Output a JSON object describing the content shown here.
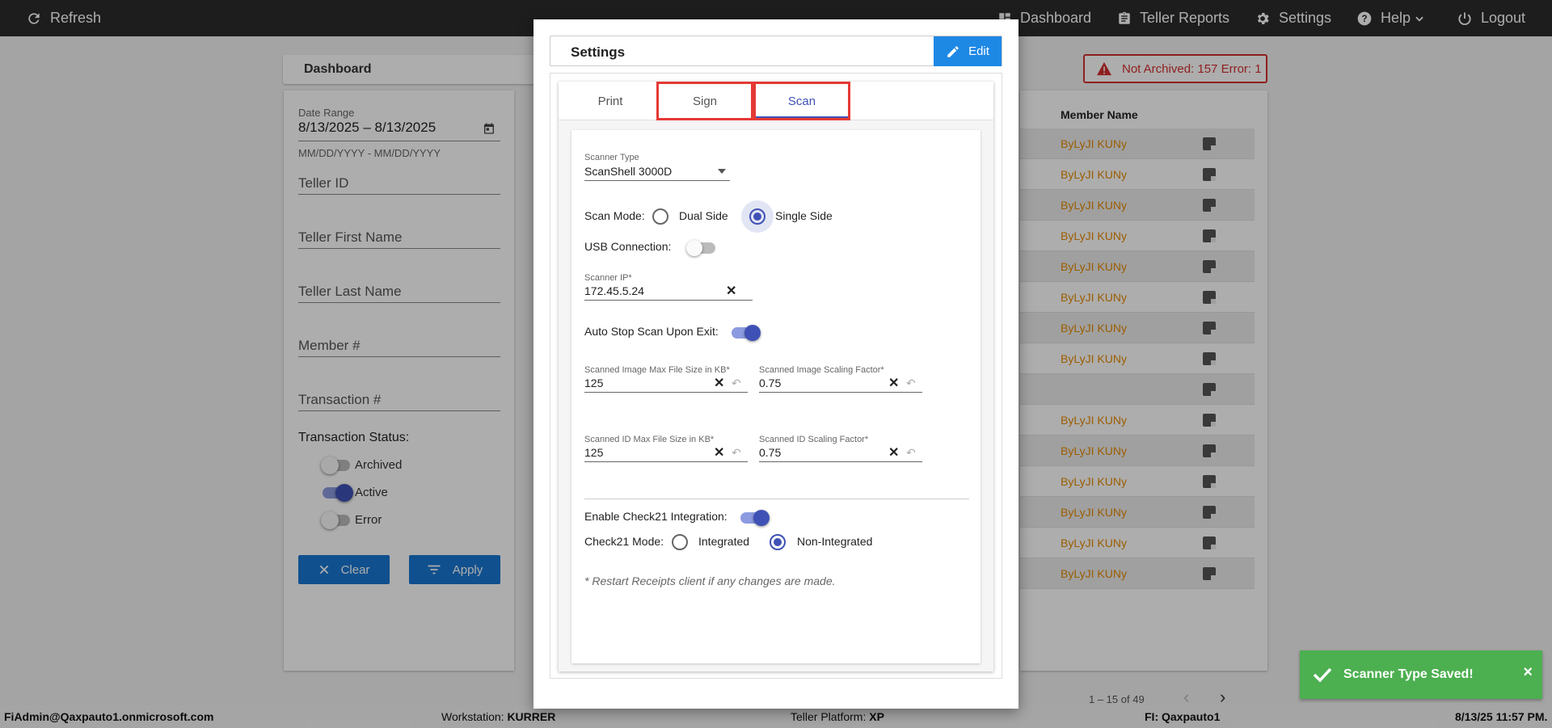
{
  "topbar": {
    "refresh_label": "Refresh",
    "dashboard_label": "Dashboard",
    "teller_reports_label": "Teller Reports",
    "settings_label": "Settings",
    "help_label": "Help",
    "logout_label": "Logout"
  },
  "dashboard": {
    "title": "Dashboard",
    "filters": {
      "date_range_label": "Date Range",
      "date_range_value": "8/13/2025 – 8/13/2025",
      "date_range_hint": "MM/DD/YYYY - MM/DD/YYYY",
      "teller_id_placeholder": "Teller ID",
      "teller_first_name_placeholder": "Teller First Name",
      "teller_last_name_placeholder": "Teller Last Name",
      "member_placeholder": "Member #",
      "transaction_placeholder": "Transaction #",
      "status_heading": "Transaction Status:",
      "statuses": [
        {
          "label": "Archived",
          "on": false
        },
        {
          "label": "Active",
          "on": true
        },
        {
          "label": "Error",
          "on": false
        }
      ],
      "clear_label": "Clear",
      "apply_label": "Apply"
    },
    "alert": {
      "text": "Not Archived: 157  Error: 1",
      "color": "#d32f2f"
    },
    "table": {
      "column_member_name": "Member Name",
      "rows": [
        "ByLyJI KUNy",
        "ByLyJI KUNy",
        "ByLyJI KUNy",
        "ByLyJI KUNy",
        "ByLyJI KUNy",
        "ByLyJI KUNy",
        "ByLyJI KUNy",
        "ByLyJI KUNy",
        "",
        "ByLyJI KUNy",
        "ByLyJI KUNy",
        "ByLyJI KUNy",
        "ByLyJI KUNy",
        "ByLyJI KUNy",
        "ByLyJI KUNy"
      ],
      "pager_text": "1 – 15 of 49"
    }
  },
  "settings_modal": {
    "title": "Settings",
    "edit_label": "Edit",
    "tabs": [
      "Print",
      "Sign",
      "Scan"
    ],
    "active_tab": "Scan",
    "scan": {
      "scanner_type_label": "Scanner Type",
      "scanner_type_value": "ScanShell 3000D",
      "scan_mode_label": "Scan Mode:",
      "scan_mode_options": [
        "Dual Side",
        "Single Side"
      ],
      "scan_mode_selected": "Single Side",
      "usb_connection_label": "USB Connection:",
      "usb_connection_on": false,
      "scanner_ip_label": "Scanner IP*",
      "scanner_ip_value": "172.45.5.24",
      "auto_stop_label": "Auto Stop Scan Upon Exit:",
      "auto_stop_on": true,
      "image_max_size_label": "Scanned Image Max File Size in KB*",
      "image_max_size_value": "125",
      "image_scaling_label": "Scanned Image Scaling Factor*",
      "image_scaling_value": "0.75",
      "id_max_size_label": "Scanned ID Max File Size in KB*",
      "id_max_size_value": "125",
      "id_scaling_label": "Scanned ID Scaling Factor*",
      "id_scaling_value": "0.75",
      "check21_enable_label": "Enable Check21 Integration:",
      "check21_enabled": true,
      "check21_mode_label": "Check21 Mode:",
      "check21_mode_options": [
        "Integrated",
        "Non-Integrated"
      ],
      "check21_mode_selected": "Non-Integrated",
      "restart_note": "* Restart Receipts client if any changes are made."
    }
  },
  "toast": {
    "message": "Scanner Type Saved!",
    "close": "×",
    "color": "#4caf50"
  },
  "statusbar": {
    "user": "FiAdmin@Qaxpauto1.onmicrosoft.com",
    "workstation_label": "Workstation:",
    "workstation_value": "KURRER",
    "platform_label": "Teller Platform:",
    "platform_value": "XP",
    "fi_label": "FI:",
    "fi_value": "Qaxpauto1",
    "datetime": "8/13/25 11:57 PM."
  },
  "colors": {
    "accent": "#3f51b5",
    "button_blue": "#1976d2",
    "name_orange": "#e58a00",
    "topbar": "#2b2b2b"
  }
}
